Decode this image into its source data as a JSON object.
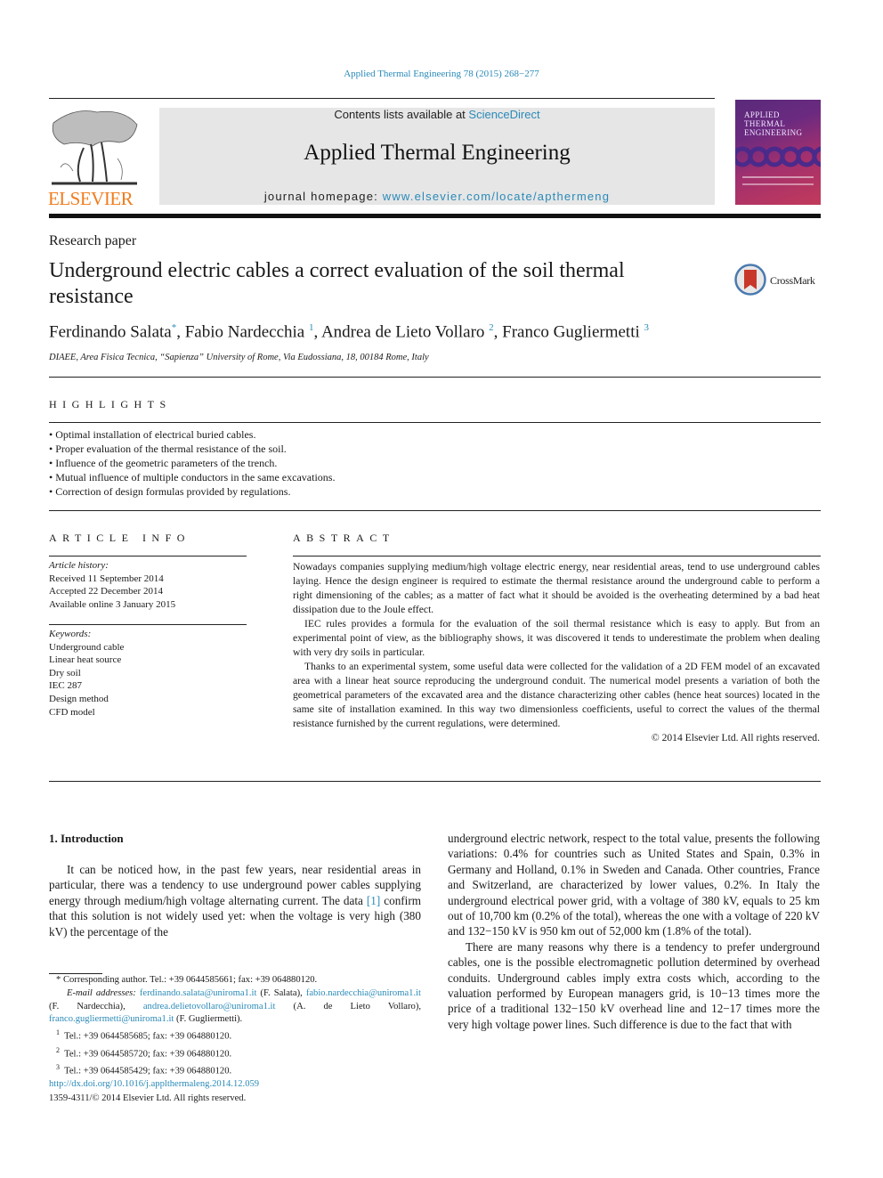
{
  "header": {
    "journal_reference": "Applied Thermal Engineering 78 (2015) 268−277",
    "contents_prefix": "Contents lists available at ",
    "contents_link": "ScienceDirect",
    "journal_title": "Applied Thermal Engineering",
    "homepage_prefix": "journal homepage: ",
    "homepage_link": "www.elsevier.com/locate/apthermeng",
    "publisher_logo": "ELSEVIER",
    "cover_title_lines": [
      "Applied",
      "Thermal",
      "Engineering"
    ],
    "colors": {
      "link": "#2a8ab8",
      "elsevier_orange": "#f07c1e",
      "masthead_bg": "#e6e6e6"
    }
  },
  "article": {
    "type": "Research paper",
    "title": "Underground electric cables a correct evaluation of the soil thermal resistance",
    "crossmark_label": "CrossMark",
    "authors": [
      {
        "name": "Ferdinando Salata",
        "mark": "*"
      },
      {
        "name": "Fabio Nardecchia",
        "mark": "1"
      },
      {
        "name": "Andrea de Lieto Vollaro",
        "mark": "2"
      },
      {
        "name": "Franco Gugliermetti",
        "mark": "3"
      }
    ],
    "affiliation": "DIAEE, Area Fisica Tecnica, “Sapienza” University of Rome, Via Eudossiana, 18, 00184 Rome, Italy"
  },
  "highlights": {
    "heading": "HIGHLIGHTS",
    "items": [
      "Optimal installation of electrical buried cables.",
      "Proper evaluation of the thermal resistance of the soil.",
      "Influence of the geometric parameters of the trench.",
      "Mutual influence of multiple conductors in the same excavations.",
      "Correction of design formulas provided by regulations."
    ]
  },
  "article_info": {
    "heading": "ARTICLE INFO",
    "history_label": "Article history:",
    "history": [
      "Received 11 September 2014",
      "Accepted 22 December 2014",
      "Available online 3 January 2015"
    ],
    "keywords_label": "Keywords:",
    "keywords": [
      "Underground cable",
      "Linear heat source",
      "Dry soil",
      "IEC 287",
      "Design method",
      "CFD model"
    ]
  },
  "abstract": {
    "heading": "ABSTRACT",
    "paragraphs": [
      "Nowadays companies supplying medium/high voltage electric energy, near residential areas, tend to use underground cables laying. Hence the design engineer is required to estimate the thermal resistance around the underground cable to perform a right dimensioning of the cables; as a matter of fact what it should be avoided is the overheating determined by a bad heat dissipation due to the Joule effect.",
      "IEC rules provides a formula for the evaluation of the soil thermal resistance which is easy to apply. But from an experimental point of view, as the bibliography shows, it was discovered it tends to underestimate the problem when dealing with very dry soils in particular.",
      "Thanks to an experimental system, some useful data were collected for the validation of a 2D FEM model of an excavated area with a linear heat source reproducing the underground conduit. The numerical model presents a variation of both the geometrical parameters of the excavated area and the distance characterizing other cables (hence heat sources) located in the same site of installation examined. In this way two dimensionless coefficients, useful to correct the values of the thermal resistance furnished by the current regulations, were determined."
    ],
    "copyright": "© 2014 Elsevier Ltd. All rights reserved."
  },
  "introduction": {
    "heading": "1.  Introduction",
    "left_p1_before_ref": "It can be noticed how, in the past few years, near residential areas in particular, there was a tendency to use underground power cables supplying energy through medium/high voltage alternating current. The data ",
    "left_ref": "[1]",
    "left_p1_after_ref": " confirm that this solution is not widely used yet: when the voltage is very high (380 kV) the percentage of the",
    "right_p1": "underground electric network, respect to the total value, presents the following variations: 0.4% for countries such as United States and Spain, 0.3% in Germany and Holland, 0.1% in Sweden and Canada. Other countries, France and Switzerland, are characterized by lower values, 0.2%. In Italy the underground electrical power grid, with a voltage of 380 kV, equals to 25 km out of 10,700 km (0.2% of the total), whereas the one with a voltage of 220 kV and 132−150 kV is 950 km out of 52,000 km (1.8% of the total).",
    "right_p2": "There are many reasons why there is a tendency to prefer underground cables, one is the possible electromagnetic pollution determined by overhead conduits. Underground cables imply extra costs which, according to the valuation performed by European managers grid, is 10−13 times more the price of a traditional 132−150 kV overhead line and 12−17 times more the very high voltage power lines. Such difference is due to the fact that with"
  },
  "footnotes": {
    "corresponding": "* Corresponding author. Tel.: +39 0644585661; fax: +39 064880120.",
    "email_label": "E-mail addresses: ",
    "emails": [
      {
        "address": "ferdinando.salata@uniroma1.it",
        "who": " (F. Salata), "
      },
      {
        "address": "fabio.nardecchia@uniroma1.it",
        "who": " (F. Nardecchia), "
      },
      {
        "address": "andrea.delietovollaro@uniroma1.it",
        "who": " (A. de Lieto Vollaro), "
      },
      {
        "address": "franco.gugliermetti@uniroma1.it",
        "who": " (F. Gugliermetti)."
      }
    ],
    "numbered": [
      {
        "mark": "1",
        "text": "Tel.: +39 0644585685; fax: +39 064880120."
      },
      {
        "mark": "2",
        "text": "Tel.: +39 0644585720; fax: +39 064880120."
      },
      {
        "mark": "3",
        "text": "Tel.: +39 0644585429; fax: +39 064880120."
      }
    ],
    "doi": "http://dx.doi.org/10.1016/j.applthermaleng.2014.12.059",
    "issn_copyright": "1359-4311/© 2014 Elsevier Ltd. All rights reserved."
  }
}
